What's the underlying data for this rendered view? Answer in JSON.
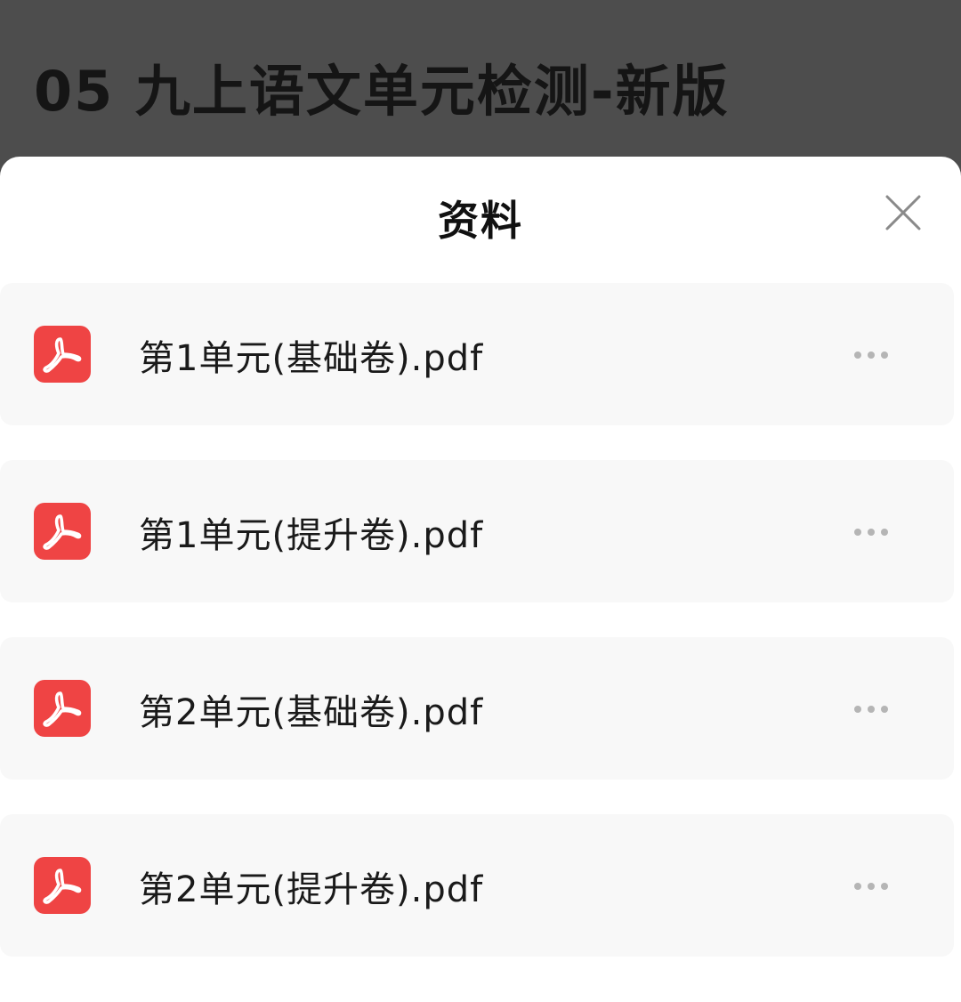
{
  "header": {
    "title": "05 九上语文单元检测-新版"
  },
  "sheet": {
    "title": "资料",
    "close_icon": "close-icon"
  },
  "files": [
    {
      "name": "第1单元(基础卷).pdf",
      "icon": "pdf-icon",
      "more_icon": "more-icon"
    },
    {
      "name": "第1单元(提升卷).pdf",
      "icon": "pdf-icon",
      "more_icon": "more-icon"
    },
    {
      "name": "第2单元(基础卷).pdf",
      "icon": "pdf-icon",
      "more_icon": "more-icon"
    },
    {
      "name": "第2单元(提升卷).pdf",
      "icon": "pdf-icon",
      "more_icon": "more-icon"
    }
  ],
  "colors": {
    "pdf_red": "#ef4444",
    "backdrop": "#4d4d4d",
    "item_bg": "#f8f8f8"
  }
}
